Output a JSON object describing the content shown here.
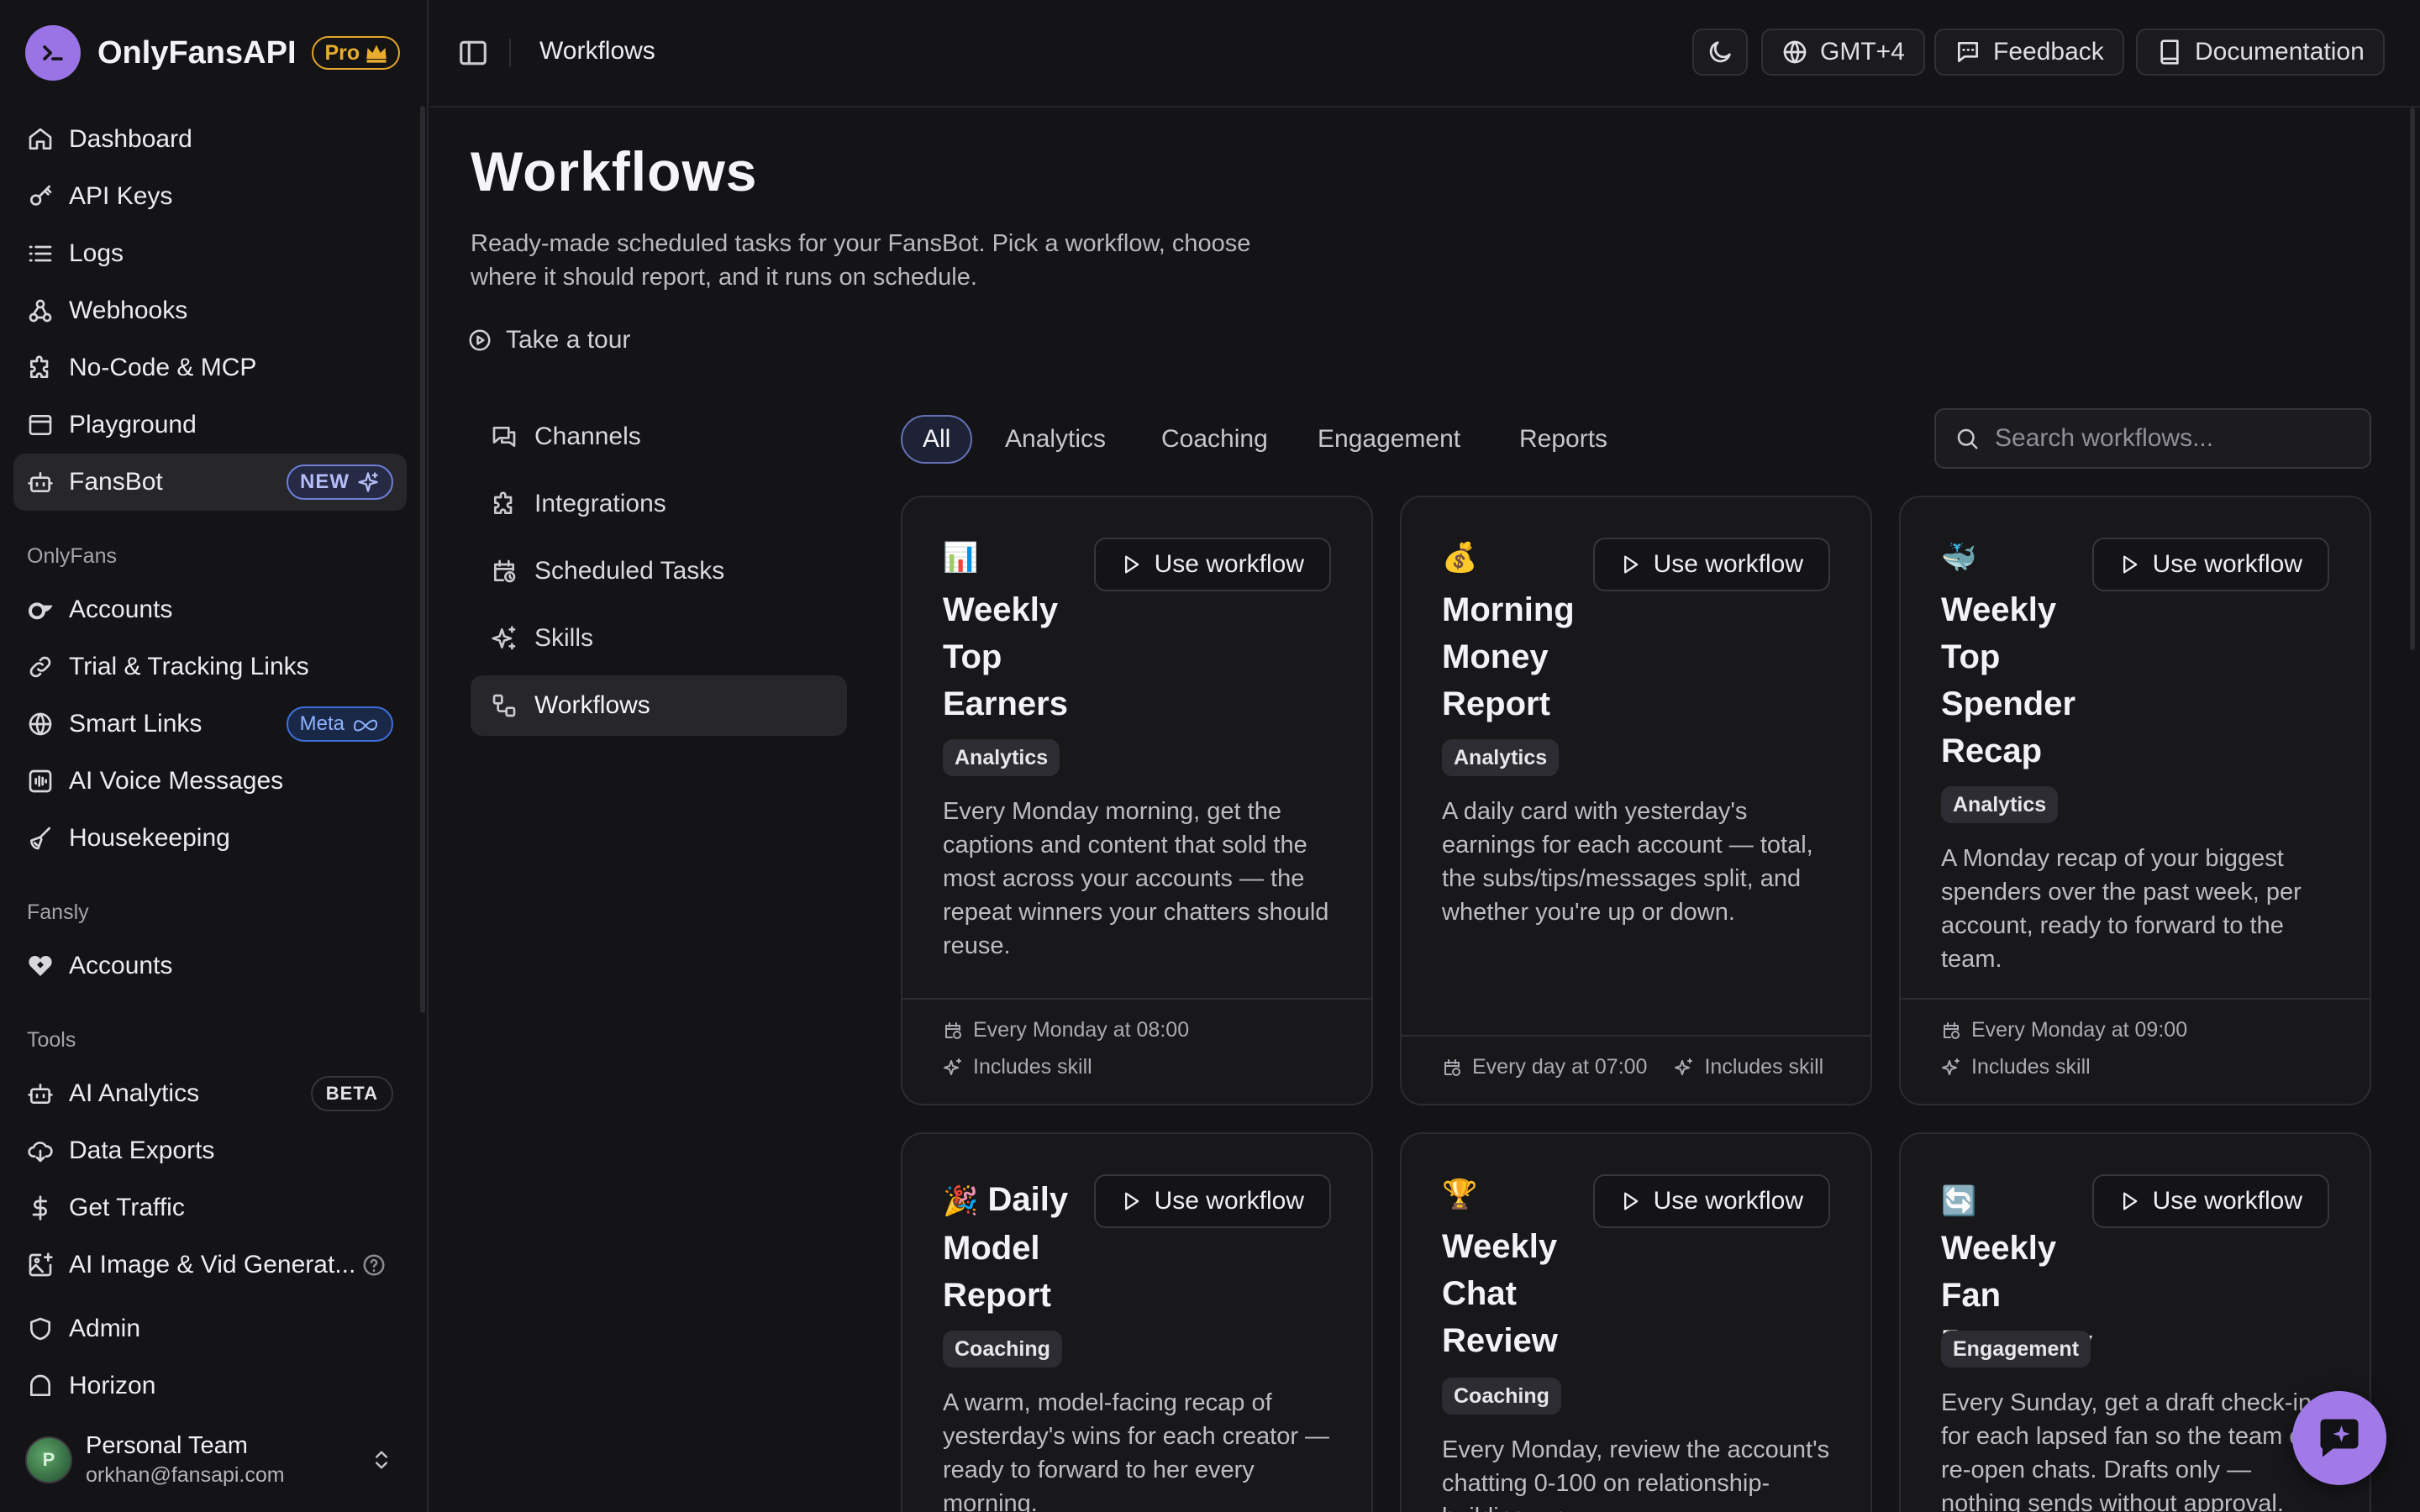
{
  "brand": {
    "name": "OnlyFansAPI",
    "badge": "Pro"
  },
  "sidebar": {
    "main": [
      {
        "label": "Dashboard",
        "icon": "home-icon"
      },
      {
        "label": "API Keys",
        "icon": "key-icon"
      },
      {
        "label": "Logs",
        "icon": "list-icon"
      },
      {
        "label": "Webhooks",
        "icon": "webhook-icon"
      },
      {
        "label": "No-Code & MCP",
        "icon": "puzzle-icon"
      },
      {
        "label": "Playground",
        "icon": "terminal-icon"
      },
      {
        "label": "FansBot",
        "icon": "bot-icon",
        "badge": "NEW",
        "active": true
      }
    ],
    "onlyfans_label": "OnlyFans",
    "onlyfans": [
      {
        "label": "Accounts",
        "icon": "onlyfans-icon"
      },
      {
        "label": "Trial & Tracking Links",
        "icon": "link-icon"
      },
      {
        "label": "Smart Links",
        "icon": "globe-icon",
        "badge": "Meta"
      },
      {
        "label": "AI Voice Messages",
        "icon": "audio-wave-icon"
      },
      {
        "label": "Housekeeping",
        "icon": "broom-icon"
      }
    ],
    "fansly_label": "Fansly",
    "fansly": [
      {
        "label": "Accounts",
        "icon": "fansly-icon"
      }
    ],
    "tools_label": "Tools",
    "tools": [
      {
        "label": "AI Analytics",
        "icon": "bot-icon",
        "badge": "BETA"
      },
      {
        "label": "Data Exports",
        "icon": "cloud-download-icon"
      },
      {
        "label": "Get Traffic",
        "icon": "dollar-icon"
      },
      {
        "label": "AI Image & Vid Generat...",
        "icon": "image-plus-icon"
      }
    ],
    "bottom": [
      {
        "label": "Admin",
        "icon": "shield-icon"
      },
      {
        "label": "Horizon",
        "icon": "horizon-icon"
      }
    ],
    "user": {
      "name": "Personal Team",
      "email": "orkhan@fansapi.com",
      "initial": "P"
    }
  },
  "topbar": {
    "title": "Workflows",
    "timezone": "GMT+4",
    "feedback": "Feedback",
    "docs": "Documentation"
  },
  "page": {
    "title": "Workflows",
    "subtitle": "Ready-made scheduled tasks for your FansBot. Pick a workflow, choose where it should report, and it runs on schedule.",
    "tour": "Take a tour"
  },
  "subnav": [
    {
      "label": "Channels",
      "icon": "chat-icon"
    },
    {
      "label": "Integrations",
      "icon": "puzzle-icon"
    },
    {
      "label": "Scheduled Tasks",
      "icon": "calendar-clock-icon"
    },
    {
      "label": "Skills",
      "icon": "sparkles-icon"
    },
    {
      "label": "Workflows",
      "icon": "workflow-icon",
      "active": true
    }
  ],
  "filters": [
    "All",
    "Analytics",
    "Coaching",
    "Engagement",
    "Reports"
  ],
  "search": {
    "placeholder": "Search workflows..."
  },
  "use_label": "Use workflow",
  "workflows": [
    {
      "emoji": "📊",
      "title": "Weekly Top Earners",
      "category": "Analytics",
      "description": "Every Monday morning, get the captions and content that sold the most across your accounts —  the repeat winners your chatters should reuse.",
      "schedule": "Every Monday at 08:00",
      "skill": "Includes skill"
    },
    {
      "emoji": "💰",
      "title": "Morning Money Report",
      "category": "Analytics",
      "description": "A daily card with yesterday's earnings for each account —  total, the subs/tips/messages split, and whether you're up or down.",
      "schedule": "Every day at 07:00",
      "skill": "Includes skill"
    },
    {
      "emoji": "🐳",
      "title": "Weekly Top Spender Recap",
      "category": "Analytics",
      "description": "A Monday recap of your biggest spenders over the past week, per account, ready to forward to the team.",
      "schedule": "Every Monday at 09:00",
      "skill": "Includes skill"
    },
    {
      "emoji": "🎉",
      "title": "Daily Model Report",
      "category": "Coaching",
      "description": "A warm, model-facing recap of yesterday's wins for each creator —  ready to forward to her every morning."
    },
    {
      "emoji": "🏆",
      "title": "Weekly Chat Review",
      "category": "Coaching",
      "description": "Every Monday, review the account's chatting 0-100 on relationship-building, up..."
    },
    {
      "emoji": "🔄",
      "title": "Weekly Fan Recovery",
      "category": "Engagement",
      "description": "Every Sunday, get a draft check-in for each lapsed fan so the team can re-open chats. Drafts only —  nothing sends without approval."
    }
  ]
}
